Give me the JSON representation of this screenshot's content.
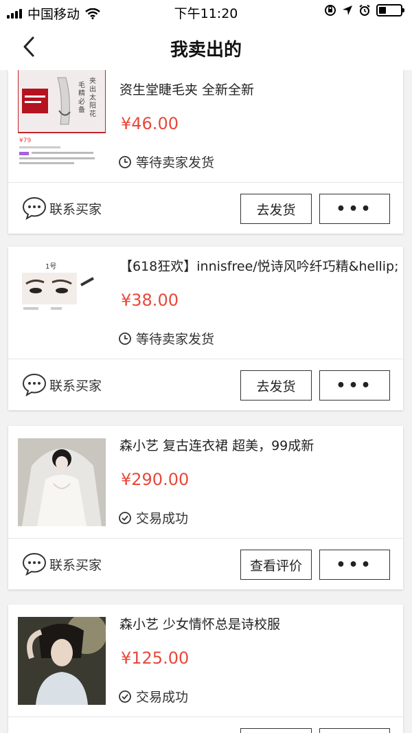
{
  "status_bar": {
    "carrier": "中国移动",
    "time": "下午11:20"
  },
  "nav": {
    "title": "我卖出的"
  },
  "orders": [
    {
      "title": "资生堂睫毛夹 全新全新",
      "price": "¥46.00",
      "status": "等待卖家发货",
      "status_icon": "clock-icon",
      "contact_label": "联系买家",
      "action_label": "去发货",
      "more_label": "•••",
      "thumb_text": [
        "毛",
        "精",
        "必",
        "备",
        "夹",
        "出",
        "太",
        "阳",
        "花"
      ],
      "thumb_price": "¥79"
    },
    {
      "title": "【618狂欢】innisfree/悦诗风吟纤巧精&hellip;",
      "price": "¥38.00",
      "status": "等待卖家发货",
      "status_icon": "clock-icon",
      "contact_label": "联系买家",
      "action_label": "去发货",
      "more_label": "•••",
      "thumb_text": [
        "1号"
      ]
    },
    {
      "title": "森小艺 复古连衣裙 超美，99成新",
      "price": "¥290.00",
      "status": "交易成功",
      "status_icon": "check-circle-icon",
      "contact_label": "联系买家",
      "action_label": "查看评价",
      "more_label": "•••"
    },
    {
      "title": "森小艺 少女情怀总是诗校服",
      "price": "¥125.00",
      "status": "交易成功",
      "status_icon": "check-circle-icon"
    }
  ],
  "colors": {
    "price": "#e8483b",
    "background": "#f2f2f2"
  }
}
